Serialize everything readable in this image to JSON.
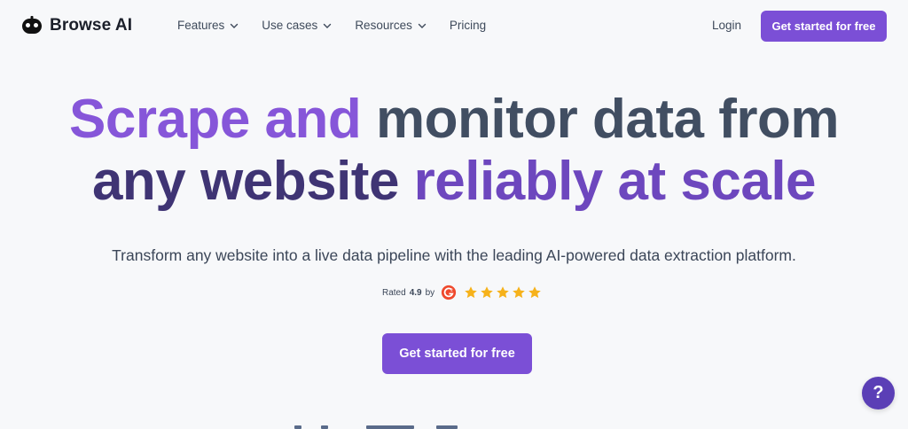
{
  "brand": {
    "name": "Browse AI",
    "icon": "robot-logo-icon"
  },
  "nav": {
    "items": [
      {
        "label": "Features",
        "has_dropdown": true
      },
      {
        "label": "Use cases",
        "has_dropdown": true
      },
      {
        "label": "Resources",
        "has_dropdown": true
      },
      {
        "label": "Pricing",
        "has_dropdown": false
      }
    ],
    "login": "Login",
    "cta": "Get started for free"
  },
  "hero": {
    "line1": {
      "part1": "Scrape and",
      "part2": "monitor data from"
    },
    "line2": {
      "part1": "any website",
      "part2": "reliably at scale"
    },
    "subtitle": "Transform any website into a live data pipeline with the leading AI-powered data extraction platform.",
    "rating": {
      "prefix": "Rated",
      "value": "4.9",
      "suffix": "by",
      "source_icon": "g2-logo-icon",
      "stars": 5
    },
    "cta": "Get started for free"
  },
  "help_button": {
    "label": "?"
  },
  "colors": {
    "accent": "#7b4fd6",
    "headline_purple": "#8656d9",
    "headline_slate": "#414e62",
    "headline_dark": "#3f3474",
    "headline_violet": "#6d47be",
    "star": "#f6b21b",
    "g2": "#ef492d",
    "help": "#5b3fb6"
  }
}
